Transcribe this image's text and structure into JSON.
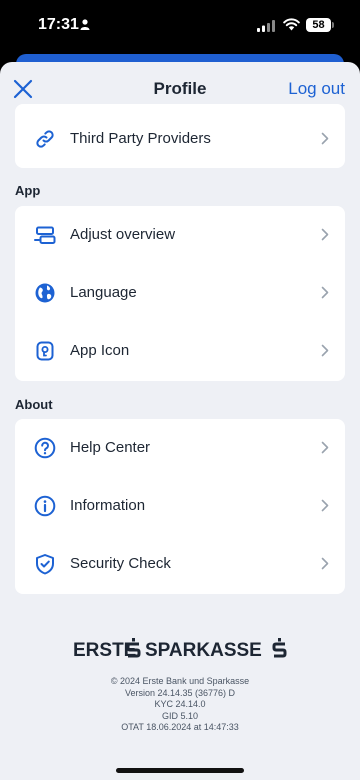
{
  "status": {
    "time": "17:31",
    "battery": "58"
  },
  "nav": {
    "title": "Profile",
    "logout": "Log out"
  },
  "top_item": {
    "label": "Third Party Providers",
    "icon": "link-icon"
  },
  "sections": {
    "app": {
      "title": "App",
      "items": [
        {
          "label": "Adjust overview",
          "icon": "layout-icon"
        },
        {
          "label": "Language",
          "icon": "globe-icon"
        },
        {
          "label": "App Icon",
          "icon": "app-icon-icon"
        }
      ]
    },
    "about": {
      "title": "About",
      "items": [
        {
          "label": "Help Center",
          "icon": "question-icon"
        },
        {
          "label": "Information",
          "icon": "info-icon"
        },
        {
          "label": "Security Check",
          "icon": "shield-check-icon"
        }
      ]
    }
  },
  "brand": {
    "left": "ERSTE",
    "right": "SPARKASSE"
  },
  "footer": {
    "copyright": "© 2024 Erste Bank und Sparkasse",
    "version": "Version 24.14.35 (36776) D",
    "kyc": "KYC 24.14.0",
    "gid": "GID 5.10",
    "otat": "OTAT 18.06.2024 at 14:47:33"
  },
  "colors": {
    "accent": "#1d62d3",
    "background": "#eef0f5",
    "text": "#1d2633"
  }
}
